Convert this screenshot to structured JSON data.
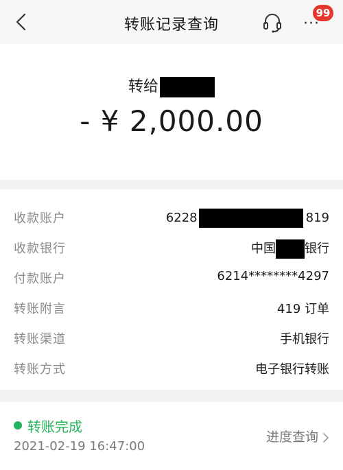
{
  "header": {
    "title": "转账记录查询",
    "back_icon": "chevron-left-icon",
    "support_icon": "headset-icon",
    "more_icon": "more-dots-icon",
    "more_dots": "···",
    "badge_count": "99"
  },
  "summary": {
    "recipient_prefix": "转给",
    "amount": "- ¥ 2,000.00"
  },
  "details": {
    "payee_account": {
      "label": "收款账户",
      "prefix": "6228",
      "suffix": "819"
    },
    "payee_bank": {
      "label": "收款银行",
      "prefix": "中国",
      "suffix": "银行"
    },
    "payer_account": {
      "label": "付款账户",
      "value": "6214********4297"
    },
    "remark": {
      "label": "转账附言",
      "value": "419 订单"
    },
    "channel": {
      "label": "转账渠道",
      "value": "手机银行"
    },
    "method": {
      "label": "转账方式",
      "value": "电子银行转账"
    }
  },
  "status": {
    "text": "转账完成",
    "time": "2021-02-19 16:47:00",
    "progress_link": "进度查询",
    "color": "#23b35a"
  }
}
